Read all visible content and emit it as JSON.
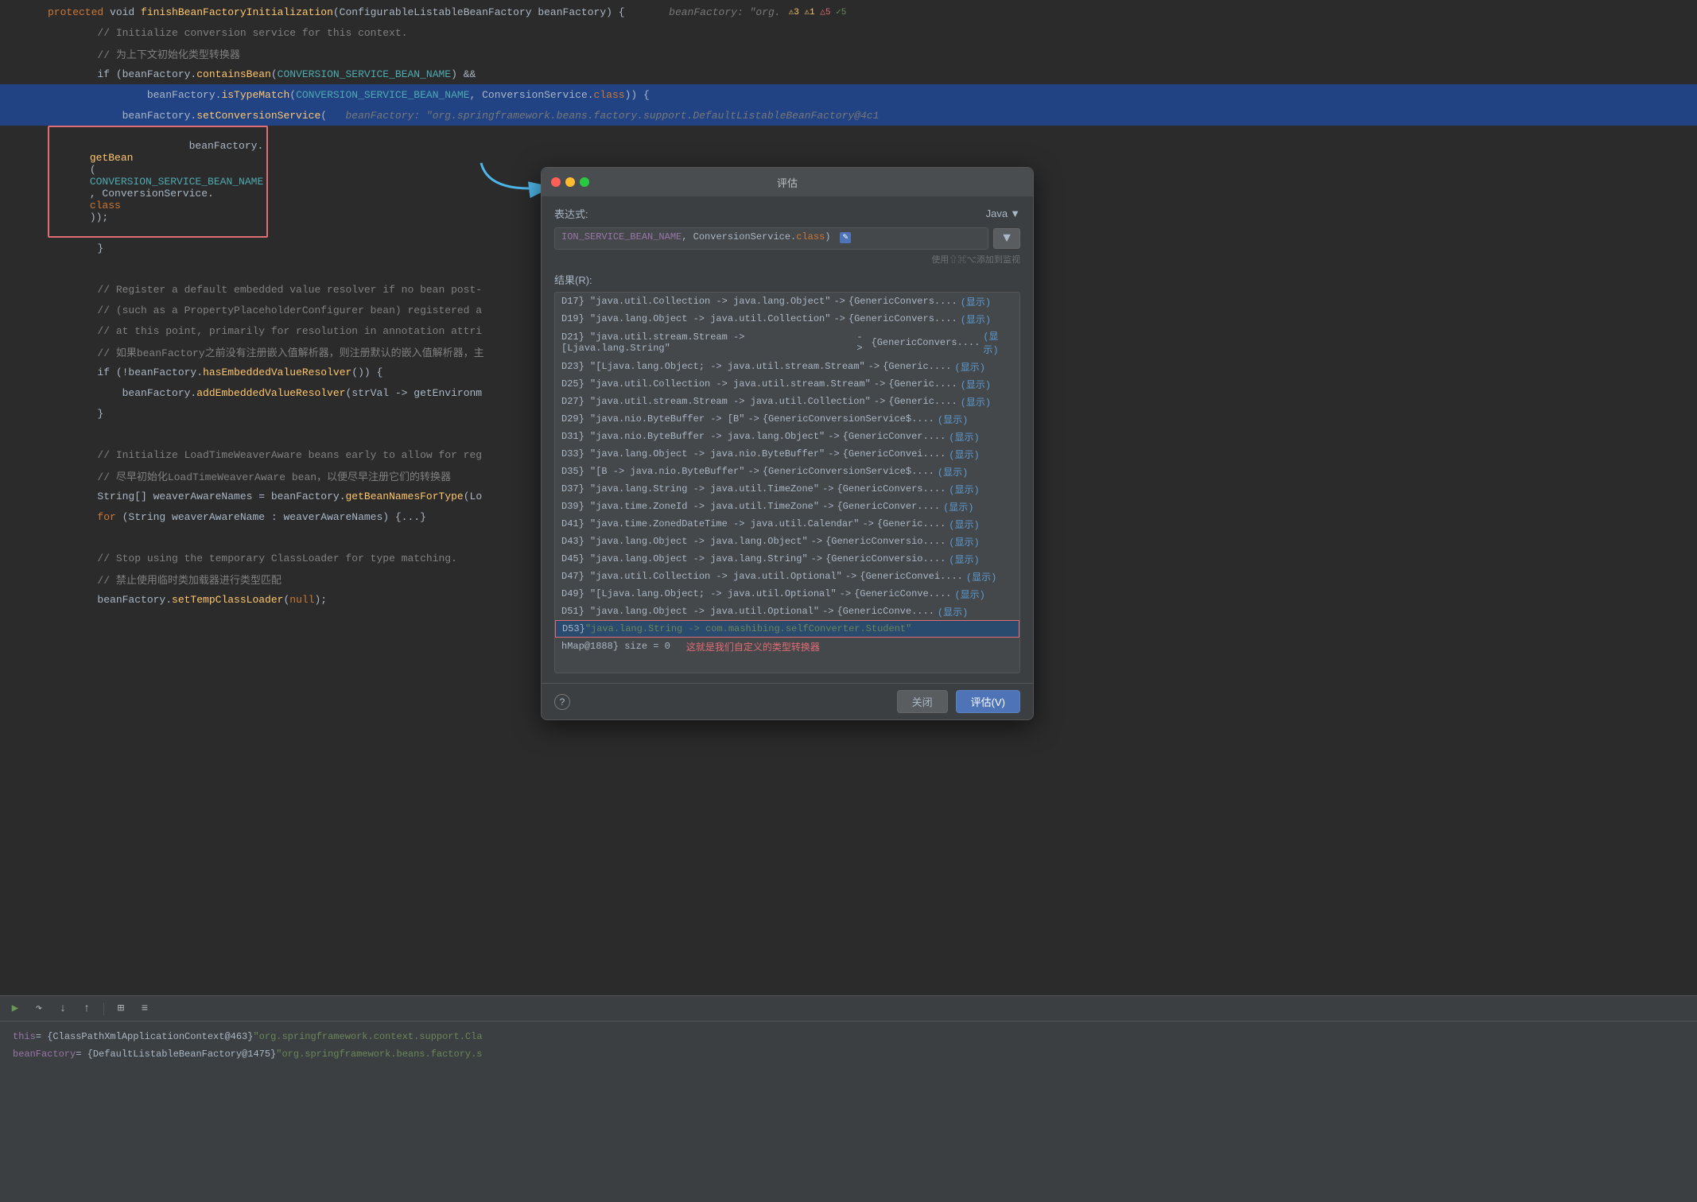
{
  "editor": {
    "lines": [
      {
        "num": "",
        "parts": [
          {
            "text": "protected",
            "cls": "kw-orange"
          },
          {
            "text": " void ",
            "cls": "kw-white"
          },
          {
            "text": "finishBeanFactoryInitialization",
            "cls": "kw-yellow"
          },
          {
            "text": "(ConfigurableListableBeanFactory beanFactory) {",
            "cls": "kw-white"
          },
          {
            "text": "   beanFactory: \"org.  ",
            "cls": "kw-italic-gray"
          },
          {
            "text": "⚠3 ⚠1 △5 ✓5",
            "cls": "kw-annotation"
          }
        ],
        "highlight": false
      },
      {
        "num": "",
        "parts": [
          {
            "text": "        // Initialize conversion service for this context.",
            "cls": "kw-gray"
          }
        ]
      },
      {
        "num": "",
        "parts": [
          {
            "text": "        // 为上下文初始化类型转换器",
            "cls": "kw-gray"
          }
        ]
      },
      {
        "num": "",
        "parts": [
          {
            "text": "        if (beanFactory.",
            "cls": "kw-white"
          },
          {
            "text": "containsBean",
            "cls": "kw-yellow"
          },
          {
            "text": "(",
            "cls": "kw-white"
          },
          {
            "text": "CONVERSION_SERVICE_BEAN_NAME",
            "cls": "kw-teal"
          },
          {
            "text": ") &&",
            "cls": "kw-white"
          }
        ]
      },
      {
        "num": "",
        "parts": [
          {
            "text": "                beanFactory.",
            "cls": "kw-white"
          },
          {
            "text": "isTypeMatch",
            "cls": "kw-yellow"
          },
          {
            "text": "(",
            "cls": "kw-white"
          },
          {
            "text": "CONVERSION_SERVICE_BEAN_NAME",
            "cls": "kw-teal"
          },
          {
            "text": ", ConversionService.",
            "cls": "kw-white"
          },
          {
            "text": "class",
            "cls": "kw-orange"
          },
          {
            "text": ")) {",
            "cls": "kw-white"
          }
        ],
        "highlight": true
      },
      {
        "num": "",
        "parts": [
          {
            "text": "            beanFactory.",
            "cls": "kw-white"
          },
          {
            "text": "setConversionService",
            "cls": "kw-yellow"
          },
          {
            "text": "(   ",
            "cls": "kw-white"
          },
          {
            "text": "beanFactory: \"org.springframework.beans.factory.support.DefaultListableBeanFactory@4c1",
            "cls": "kw-italic-gray"
          }
        ],
        "highlight": true
      },
      {
        "num": "",
        "parts": [
          {
            "text": "                beanFactory.",
            "cls": "kw-white"
          },
          {
            "text": "getBean",
            "cls": "kw-yellow"
          },
          {
            "text": "(",
            "cls": "kw-white"
          },
          {
            "text": "CONVERSION_SERVICE_BEAN_NAME",
            "cls": "kw-teal"
          },
          {
            "text": ", ConversionService.",
            "cls": "kw-white"
          },
          {
            "text": "class",
            "cls": "kw-orange"
          },
          {
            "text": "));",
            "cls": "kw-white"
          }
        ],
        "hasBox": true
      },
      {
        "num": "",
        "parts": [
          {
            "text": "        }",
            "cls": "kw-white"
          }
        ]
      },
      {
        "num": "",
        "parts": []
      },
      {
        "num": "",
        "parts": [
          {
            "text": "        // Register a default embedded value resolver if no bean post-",
            "cls": "kw-gray"
          }
        ]
      },
      {
        "num": "",
        "parts": [
          {
            "text": "        // (such as a PropertyPlaceholderConfigurer bean) registered a",
            "cls": "kw-gray"
          }
        ]
      },
      {
        "num": "",
        "parts": [
          {
            "text": "        // at this point, primarily for resolution in annotation attri",
            "cls": "kw-gray"
          }
        ]
      },
      {
        "num": "",
        "parts": [
          {
            "text": "        // 如果beanFactory之前没有注册嵌入值解析器，则注册默认的嵌入值解析器，主",
            "cls": "kw-gray"
          }
        ]
      },
      {
        "num": "",
        "parts": [
          {
            "text": "        if (!",
            "cls": "kw-white"
          },
          {
            "text": "beanFactory",
            "cls": "kw-white"
          },
          {
            "text": ".",
            "cls": "kw-white"
          },
          {
            "text": "hasEmbeddedValueResolver",
            "cls": "kw-yellow"
          },
          {
            "text": "()) {",
            "cls": "kw-white"
          }
        ]
      },
      {
        "num": "",
        "parts": [
          {
            "text": "            beanFactory.",
            "cls": "kw-white"
          },
          {
            "text": "addEmbeddedValueResolver",
            "cls": "kw-yellow"
          },
          {
            "text": "(strVal -> getEnvironm",
            "cls": "kw-white"
          }
        ]
      },
      {
        "num": "",
        "parts": [
          {
            "text": "        }",
            "cls": "kw-white"
          }
        ]
      },
      {
        "num": "",
        "parts": []
      },
      {
        "num": "",
        "parts": [
          {
            "text": "        // Initialize LoadTimeWeaverAware beans early to allow for reg",
            "cls": "kw-gray"
          }
        ]
      },
      {
        "num": "",
        "parts": [
          {
            "text": "        // 尽早初始化LoadTimeWeaverAware bean，以便尽早注册它们的转换器",
            "cls": "kw-gray"
          }
        ]
      },
      {
        "num": "",
        "parts": [
          {
            "text": "        String[] weaverAwareNames = ",
            "cls": "kw-white"
          },
          {
            "text": "beanFactory",
            "cls": "kw-white"
          },
          {
            "text": ".",
            "cls": "kw-white"
          },
          {
            "text": "getBeanNamesForType",
            "cls": "kw-yellow"
          },
          {
            "text": "(Lo",
            "cls": "kw-white"
          }
        ]
      },
      {
        "num": "",
        "parts": [
          {
            "text": "        for (String weaverAwareName : weaverAwareNames) {...}",
            "cls": "kw-white"
          }
        ]
      },
      {
        "num": "",
        "parts": []
      },
      {
        "num": "",
        "parts": [
          {
            "text": "        // Stop using the temporary ClassLoader for type matching.",
            "cls": "kw-gray"
          }
        ]
      },
      {
        "num": "",
        "parts": [
          {
            "text": "        // 禁止使用临时类加载器进行类型匹配",
            "cls": "kw-gray"
          }
        ]
      },
      {
        "num": "",
        "parts": [
          {
            "text": "        beanFactory.",
            "cls": "kw-white"
          },
          {
            "text": "setTempClassLoader",
            "cls": "kw-yellow"
          },
          {
            "text": "(",
            "cls": "kw-white"
          },
          {
            "text": "null",
            "cls": "kw-orange"
          },
          {
            "text": ");",
            "cls": "kw-white"
          }
        ]
      }
    ]
  },
  "bottom_panel": {
    "toolbar_icons": [
      "↑",
      "↕",
      "↗",
      "⊞",
      "≡"
    ],
    "vars": [
      {
        "name": "this",
        "value": "= {ClassPathXmlApplicationContext@463} \"org.springframework.context.support.Cla"
      },
      {
        "name": "beanFactory",
        "value": "= {DefaultListableBeanFactory@1475} \"org.springframework.beans.factory.s"
      }
    ]
  },
  "eval_dialog": {
    "title": "评估",
    "expr_label": "表达式:",
    "lang_label": "Java",
    "expr_value": "ION_SERVICE_BEAN_NAME, ConversionService.class)",
    "watch_hint": "使用⇧⌘⌥添加到监视",
    "result_label": "结果(R):",
    "results": [
      {
        "key": "D17} \"java.util.Collection -> java.lang.Object\"",
        "arrow": "->",
        "val": "{GenericConvers....",
        "show": "(显示)"
      },
      {
        "key": "D19} \"java.lang.Object -> java.util.Collection\"",
        "arrow": "->",
        "val": "{GenericConvers....",
        "show": "(显示)"
      },
      {
        "key": "D21} \"java.util.stream.Stream -> [Ljava.lang.String\"",
        "arrow": "->",
        "val": "{GenericConvers....",
        "show": "(显示)"
      },
      {
        "key": "D23} \"[Ljava.lang.Object; -> java.util.stream.Stream\"",
        "arrow": "->",
        "val": "{Generic....",
        "show": "(显示)"
      },
      {
        "key": "D25} \"java.util.Collection -> java.util.stream.Stream\"",
        "arrow": "->",
        "val": "{Generic....",
        "show": "(显示)"
      },
      {
        "key": "D27} \"java.util.stream.Stream -> java.util.Collection\"",
        "arrow": "->",
        "val": "{Generic....",
        "show": "(显示)"
      },
      {
        "key": "D29} \"java.nio.ByteBuffer -> [B\"",
        "arrow": "->",
        "val": "{GenericConversionService$....",
        "show": "(显示)"
      },
      {
        "key": "D31} \"java.nio.ByteBuffer -> java.lang.Object\"",
        "arrow": "->",
        "val": "{GenericConver....",
        "show": "(显示)"
      },
      {
        "key": "D33} \"java.lang.Object -> java.nio.ByteBuffer\"",
        "arrow": "->",
        "val": "{GenericConvei....",
        "show": "(显示)"
      },
      {
        "key": "D35} \"[B -> java.nio.ByteBuffer\"",
        "arrow": "->",
        "val": "{GenericConversionService$....",
        "show": "(显示)"
      },
      {
        "key": "D37} \"java.lang.String -> java.util.TimeZone\"",
        "arrow": "->",
        "val": "{GenericConvers....",
        "show": "(显示)"
      },
      {
        "key": "D39} \"java.time.ZoneId -> java.util.TimeZone\"",
        "arrow": "->",
        "val": "{GenericConver....",
        "show": "(显示)"
      },
      {
        "key": "D41} \"java.time.ZonedDateTime -> java.util.Calendar\"",
        "arrow": "->",
        "val": "{Generic....",
        "show": "(显示)"
      },
      {
        "key": "D43} \"java.lang.Object -> java.lang.Object\"",
        "arrow": "->",
        "val": "{GenericConversio....",
        "show": "(显示)"
      },
      {
        "key": "D45} \"java.lang.Object -> java.lang.String\"",
        "arrow": "->",
        "val": "{GenericConversio....",
        "show": "(显示)"
      },
      {
        "key": "D47} \"java.util.Collection -> java.util.Optional\"",
        "arrow": "->",
        "val": "{GenericConvei....",
        "show": "(显示)"
      },
      {
        "key": "D49} \"[Ljava.lang.Object; -> java.util.Optional\"",
        "arrow": "->",
        "val": "{GenericConve....",
        "show": "(显示)"
      },
      {
        "key": "D51} \"java.lang.Object -> java.util.Optional\"",
        "arrow": "->",
        "val": "{GenericConve....",
        "show": "(显示)"
      },
      {
        "key": "D53} \"java.lang.String -> com.mashibing.selfConverter.Student\"",
        "arrow": "",
        "val": "",
        "show": "",
        "highlighted": true
      }
    ],
    "annotation_red": "这就是我们自定义的类型转换器",
    "result_extra": "hMap@1888}  size = 0",
    "close_label": "关闭",
    "eval_label": "评估(V)",
    "help_label": "?"
  }
}
